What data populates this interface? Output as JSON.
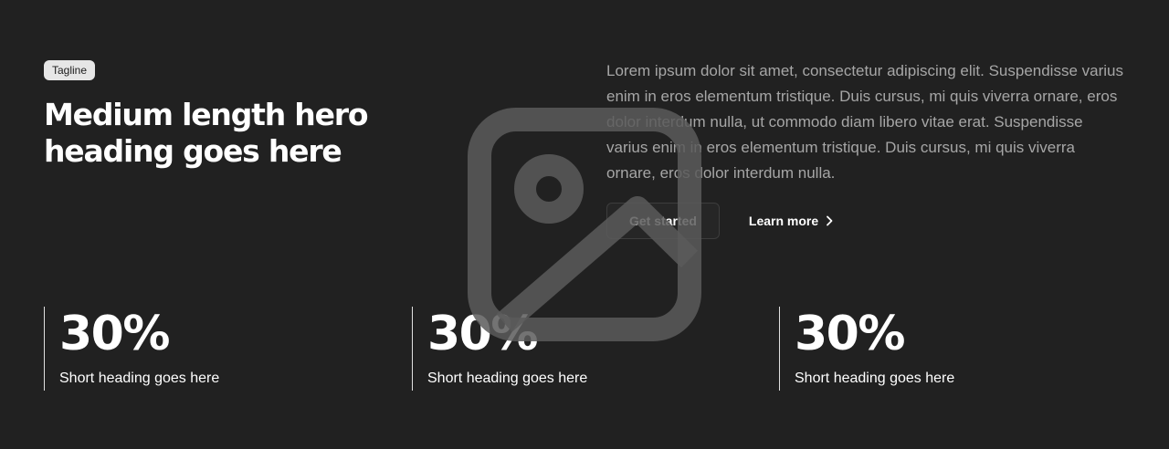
{
  "hero": {
    "tagline": "Tagline",
    "heading": "Medium length hero heading goes here",
    "body": "Lorem ipsum dolor sit amet, consectetur adipiscing elit. Suspendisse varius enim in eros elementum tristique. Duis cursus, mi quis viverra ornare, eros dolor interdum nulla, ut commodo diam libero vitae erat. Suspendisse varius enim in eros elementum tristique. Duis cursus, mi quis viverra ornare, eros dolor interdum nulla.",
    "primary_button": "Get started",
    "secondary_button": "Learn more",
    "secondary_icon": "chevron-right-icon",
    "background_icon": "image-placeholder-icon"
  },
  "stats": [
    {
      "value": "30%",
      "label": "Short heading goes here"
    },
    {
      "value": "30%",
      "label": "Short heading goes here"
    },
    {
      "value": "30%",
      "label": "Short heading goes here"
    }
  ],
  "colors": {
    "background": "#212121",
    "text": "#ffffff",
    "body_text": "#a6a6a6",
    "tagline_bg": "#e6e6e6",
    "placeholder_icon": "#5a5a5a"
  }
}
